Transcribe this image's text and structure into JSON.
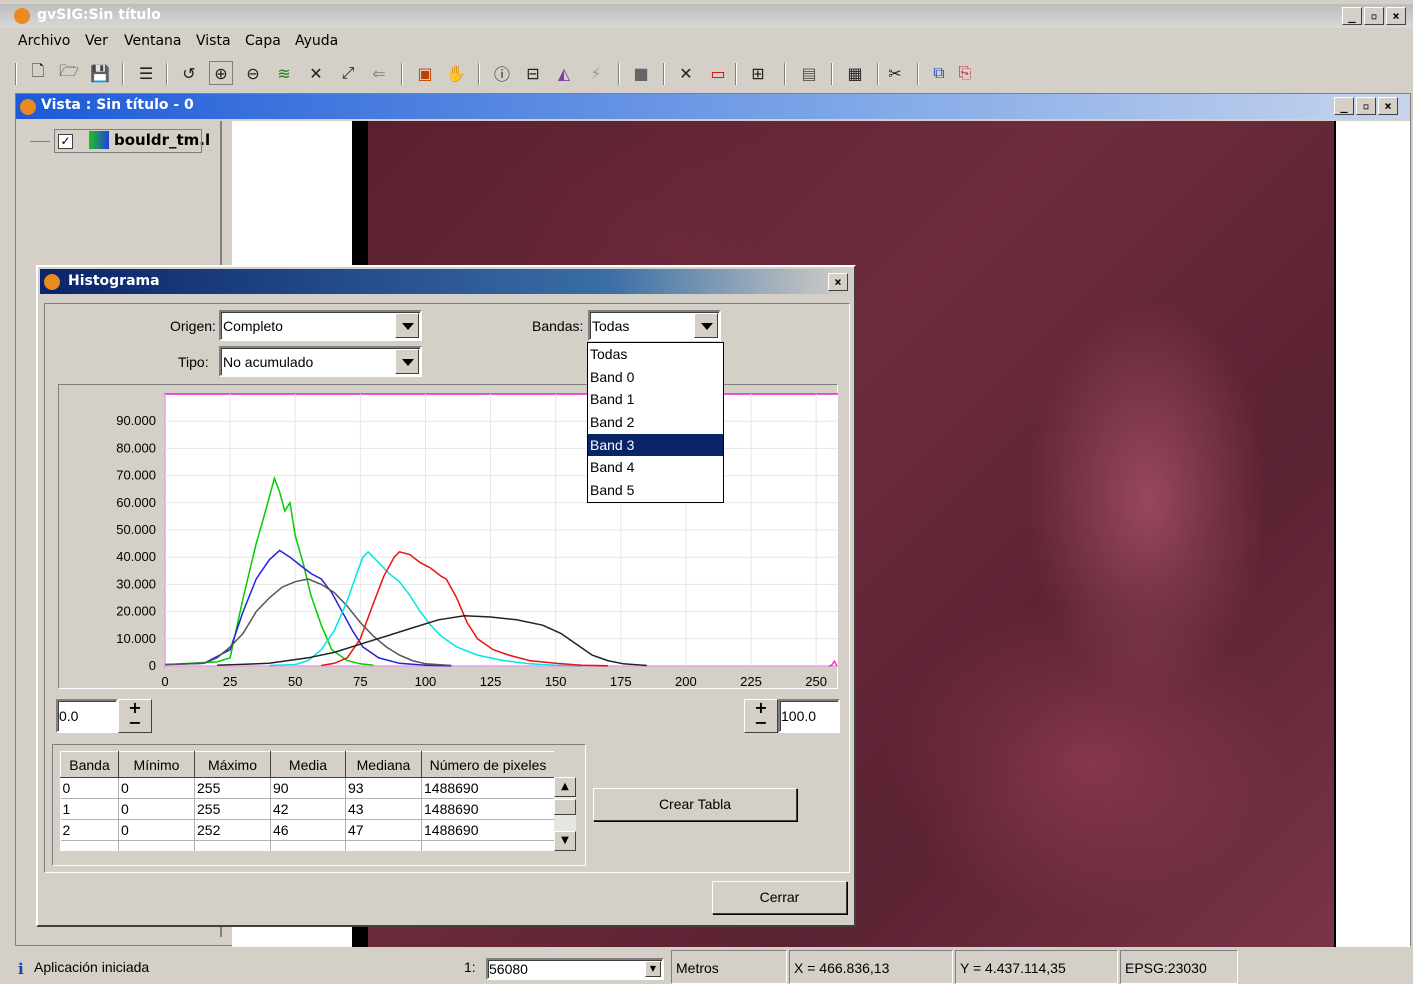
{
  "app": {
    "title": "gvSIG:Sin título"
  },
  "menu": [
    "Archivo",
    "Ver",
    "Ventana",
    "Vista",
    "Capa",
    "Ayuda"
  ],
  "view_window": {
    "title": "Vista : Sin título - 0"
  },
  "toc": {
    "layer_name": "bouldr_tm.l",
    "checked": true
  },
  "histogram_dialog": {
    "title": "Histograma",
    "origen_label": "Origen:",
    "origen_value": "Completo",
    "tipo_label": "Tipo:",
    "tipo_value": "No acumulado",
    "bandas_label": "Bandas:",
    "bandas_value": "Todas",
    "bandas_options": [
      "Todas",
      "Band 0",
      "Band 1",
      "Band 2",
      "Band 3",
      "Band 4",
      "Band 5"
    ],
    "bandas_highlighted": "Band 3",
    "min_value": "0.0",
    "max_value": "100.0",
    "crear_tabla_label": "Crear Tabla",
    "cerrar_label": "Cerrar",
    "table": {
      "headers": [
        "Banda",
        "Mínimo",
        "Máximo",
        "Media",
        "Mediana",
        "Número de pixeles"
      ],
      "rows": [
        [
          "0",
          "0",
          "255",
          "90",
          "93",
          "1488690"
        ],
        [
          "1",
          "0",
          "255",
          "42",
          "43",
          "1488690"
        ],
        [
          "2",
          "0",
          "252",
          "46",
          "47",
          "1488690"
        ]
      ]
    }
  },
  "chart_data": {
    "type": "line",
    "x_ticks": [
      0,
      25,
      50,
      75,
      100,
      125,
      150,
      175,
      200,
      225,
      250
    ],
    "y_tick_labels": [
      "0",
      "10.000",
      "20.000",
      "30.000",
      "40.000",
      "50.000",
      "60.000",
      "70.000",
      "80.000",
      "90.000"
    ],
    "y_ticks": [
      0,
      10000,
      20000,
      30000,
      40000,
      50000,
      60000,
      70000,
      80000,
      90000
    ],
    "xlim": [
      0,
      268
    ],
    "ylim": [
      0,
      100000
    ],
    "grid": true,
    "series": [
      {
        "color": "#00cc00",
        "points": [
          [
            0,
            500
          ],
          [
            10,
            1000
          ],
          [
            20,
            1500
          ],
          [
            25,
            3000
          ],
          [
            30,
            25000
          ],
          [
            35,
            45000
          ],
          [
            38,
            55000
          ],
          [
            40,
            62000
          ],
          [
            42,
            69000
          ],
          [
            44,
            64000
          ],
          [
            46,
            57000
          ],
          [
            48,
            60000
          ],
          [
            50,
            48000
          ],
          [
            53,
            38000
          ],
          [
            56,
            26000
          ],
          [
            60,
            15000
          ],
          [
            64,
            6000
          ],
          [
            70,
            2000
          ],
          [
            75,
            800
          ],
          [
            80,
            300
          ]
        ]
      },
      {
        "color": "#2222dd",
        "points": [
          [
            0,
            500
          ],
          [
            15,
            1000
          ],
          [
            25,
            6000
          ],
          [
            30,
            20000
          ],
          [
            35,
            32000
          ],
          [
            40,
            39000
          ],
          [
            44,
            42500
          ],
          [
            48,
            40000
          ],
          [
            52,
            37000
          ],
          [
            56,
            34000
          ],
          [
            60,
            32000
          ],
          [
            64,
            27000
          ],
          [
            68,
            20000
          ],
          [
            72,
            13000
          ],
          [
            76,
            7000
          ],
          [
            82,
            3000
          ],
          [
            90,
            1000
          ],
          [
            100,
            300
          ],
          [
            110,
            100
          ]
        ]
      },
      {
        "color": "#555555",
        "points": [
          [
            0,
            500
          ],
          [
            10,
            800
          ],
          [
            15,
            1000
          ],
          [
            20,
            3000
          ],
          [
            25,
            7000
          ],
          [
            30,
            12000
          ],
          [
            35,
            20000
          ],
          [
            40,
            25000
          ],
          [
            45,
            29000
          ],
          [
            50,
            31000
          ],
          [
            55,
            32000
          ],
          [
            60,
            30000
          ],
          [
            65,
            27000
          ],
          [
            70,
            22000
          ],
          [
            75,
            16000
          ],
          [
            80,
            11000
          ],
          [
            85,
            7000
          ],
          [
            90,
            4000
          ],
          [
            95,
            2000
          ],
          [
            100,
            800
          ],
          [
            110,
            200
          ]
        ]
      },
      {
        "color": "#00e5e5",
        "points": [
          [
            40,
            200
          ],
          [
            50,
            500
          ],
          [
            55,
            2000
          ],
          [
            60,
            6000
          ],
          [
            65,
            13000
          ],
          [
            70,
            24000
          ],
          [
            74,
            35000
          ],
          [
            76,
            40000
          ],
          [
            78,
            42000
          ],
          [
            82,
            38000
          ],
          [
            86,
            34000
          ],
          [
            90,
            31000
          ],
          [
            94,
            26000
          ],
          [
            98,
            20000
          ],
          [
            102,
            15000
          ],
          [
            106,
            11000
          ],
          [
            112,
            7000
          ],
          [
            120,
            4000
          ],
          [
            130,
            2000
          ],
          [
            140,
            800
          ],
          [
            150,
            300
          ],
          [
            160,
            100
          ]
        ]
      },
      {
        "color": "#ee1111",
        "points": [
          [
            60,
            200
          ],
          [
            65,
            1000
          ],
          [
            70,
            3000
          ],
          [
            75,
            10000
          ],
          [
            80,
            23000
          ],
          [
            84,
            33000
          ],
          [
            88,
            40000
          ],
          [
            90,
            42000
          ],
          [
            94,
            41000
          ],
          [
            98,
            38000
          ],
          [
            102,
            36000
          ],
          [
            106,
            33000
          ],
          [
            108,
            32000
          ],
          [
            112,
            25000
          ],
          [
            116,
            16000
          ],
          [
            120,
            10000
          ],
          [
            126,
            6000
          ],
          [
            132,
            4000
          ],
          [
            140,
            2000
          ],
          [
            150,
            1000
          ],
          [
            160,
            300
          ],
          [
            170,
            100
          ]
        ]
      },
      {
        "color": "#222222",
        "points": [
          [
            20,
            300
          ],
          [
            40,
            1000
          ],
          [
            55,
            3000
          ],
          [
            65,
            5000
          ],
          [
            75,
            8000
          ],
          [
            85,
            11000
          ],
          [
            95,
            14000
          ],
          [
            105,
            17000
          ],
          [
            115,
            18500
          ],
          [
            125,
            18000
          ],
          [
            135,
            17000
          ],
          [
            145,
            15000
          ],
          [
            152,
            12000
          ],
          [
            158,
            8000
          ],
          [
            164,
            4000
          ],
          [
            170,
            2000
          ],
          [
            176,
            800
          ],
          [
            185,
            200
          ]
        ]
      },
      {
        "color": "#ff33cc",
        "points": [
          [
            255,
            0
          ],
          [
            256,
            300
          ],
          [
            257,
            1800
          ],
          [
            258,
            0
          ]
        ]
      }
    ]
  },
  "statusbar": {
    "message": "Aplicación iniciada",
    "scale_prefix": "1:",
    "scale_value": "56080",
    "units": "Metros",
    "x_coord": "X = 466.836,13",
    "y_coord": "Y = 4.437.114,35",
    "epsg": "EPSG:23030"
  },
  "colors": {
    "dialog_title_bg": "#0a246a",
    "highlight": "#0a246a",
    "map_tint": "#6b2a3a"
  }
}
